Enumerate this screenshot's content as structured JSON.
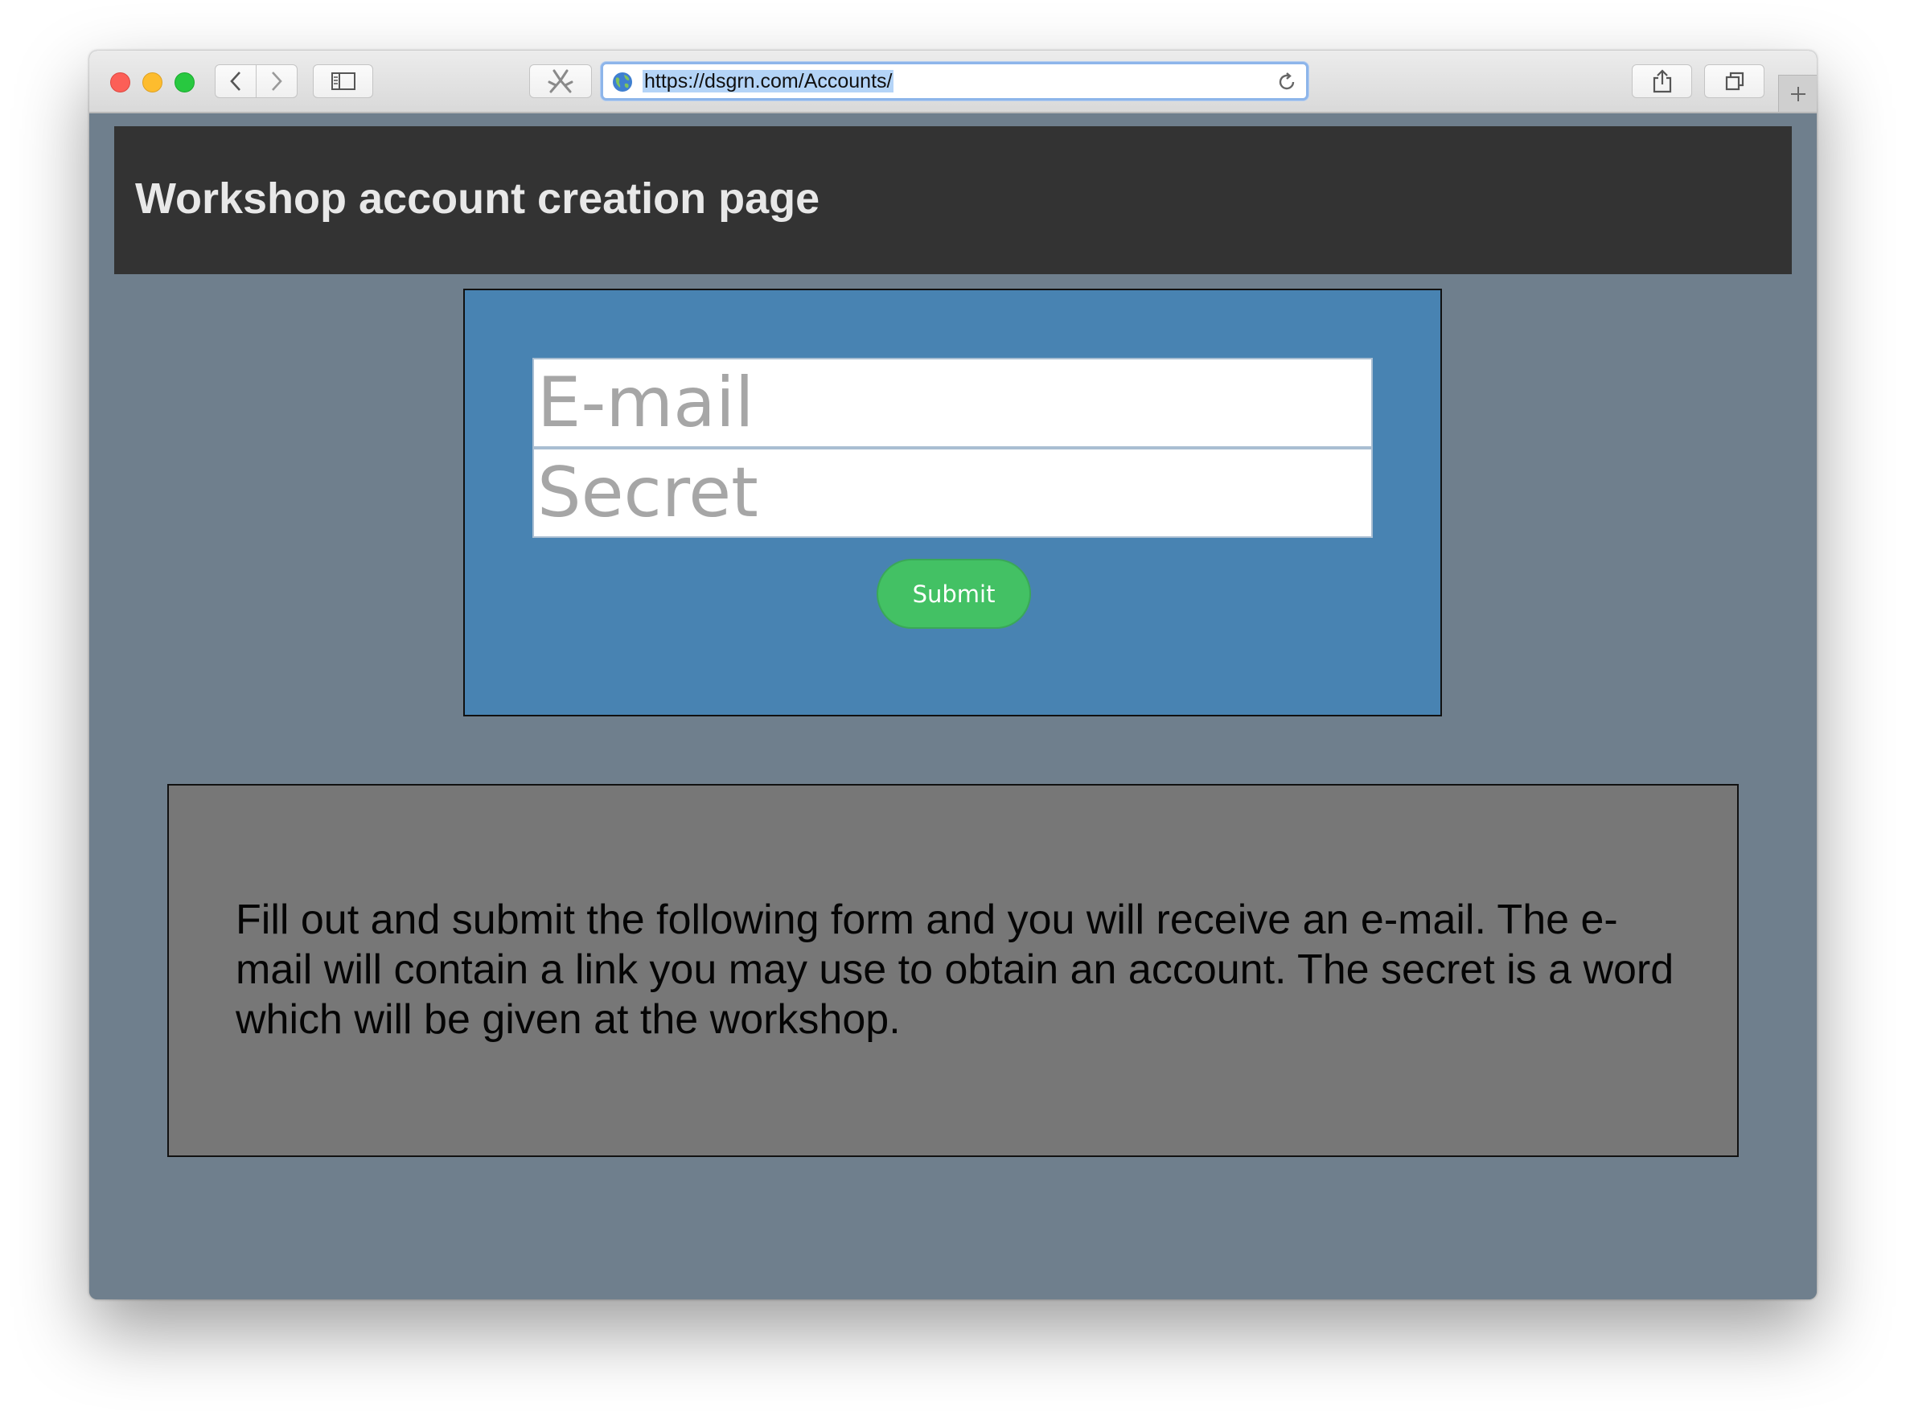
{
  "browser": {
    "url": "https://dsgrn.com/Accounts/",
    "icons": {
      "back": "chevron-left-icon",
      "forward": "chevron-right-icon",
      "sidebar": "sidebar-icon",
      "extension": "extension-icon",
      "site": "globe-icon",
      "reload": "reload-icon",
      "share": "share-icon",
      "tabs": "tabs-overview-icon",
      "new_tab": "plus-icon"
    }
  },
  "page": {
    "title": "Workshop account creation page",
    "form": {
      "email_placeholder": "E-mail",
      "secret_placeholder": "Secret",
      "submit_label": "Submit"
    },
    "info": "Fill out and submit the following form and you will receive an e-mail. The e-mail will contain a link you may use to obtain an account. The secret is a word which will be given at the workshop."
  },
  "colors": {
    "page_background": "#6f7f8d",
    "header_background": "#333333",
    "form_background": "#4883b2",
    "submit_background": "#43c164",
    "info_background": "#777777"
  }
}
